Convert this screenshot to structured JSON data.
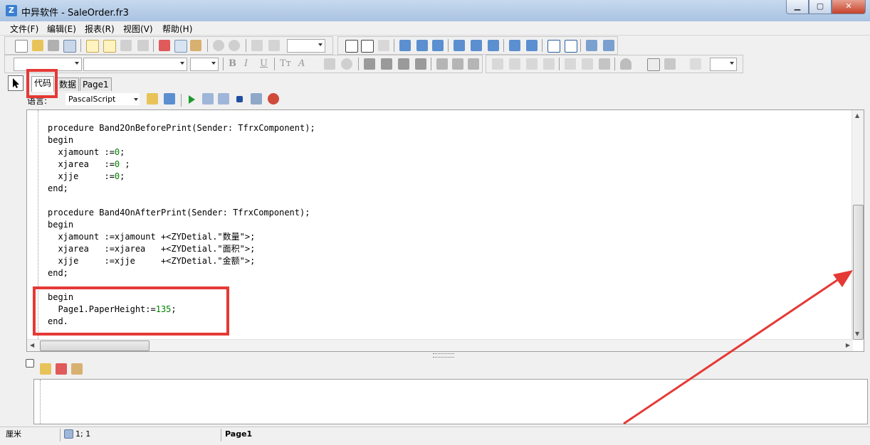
{
  "window": {
    "title": "中异软件 - SaleOrder.fr3"
  },
  "menu": [
    "文件(F)",
    "编辑(E)",
    "报表(R)",
    "视图(V)",
    "帮助(H)"
  ],
  "tabs": [
    {
      "label": "代码",
      "active": true
    },
    {
      "label": "数据",
      "active": false
    },
    {
      "label": "Page1",
      "active": false
    }
  ],
  "language": {
    "label": "语言:",
    "value": "PascalScript"
  },
  "code_lines": [
    "procedure Band2OnBeforePrint(Sender: TfrxComponent);",
    "begin",
    "  xjamount :=0;",
    "  xjarea   :=0 ;",
    "  xjje     :=0;",
    "end;",
    "",
    "procedure Band4OnAfterPrint(Sender: TfrxComponent);",
    "begin",
    "  xjamount :=xjamount +<ZYDetial.\"数量\">;",
    "  xjarea   :=xjarea   +<ZYDetial.\"面积\">;",
    "  xjje     :=xjje     +<ZYDetial.\"金额\">;",
    "end;",
    "",
    "begin",
    "  Page1.PaperHeight:=135;",
    "end."
  ],
  "statusbar": {
    "unit": "厘米",
    "position": "1; 1",
    "page": "Page1"
  },
  "colors": {
    "highlight": "#e53935",
    "number": "#008000"
  }
}
